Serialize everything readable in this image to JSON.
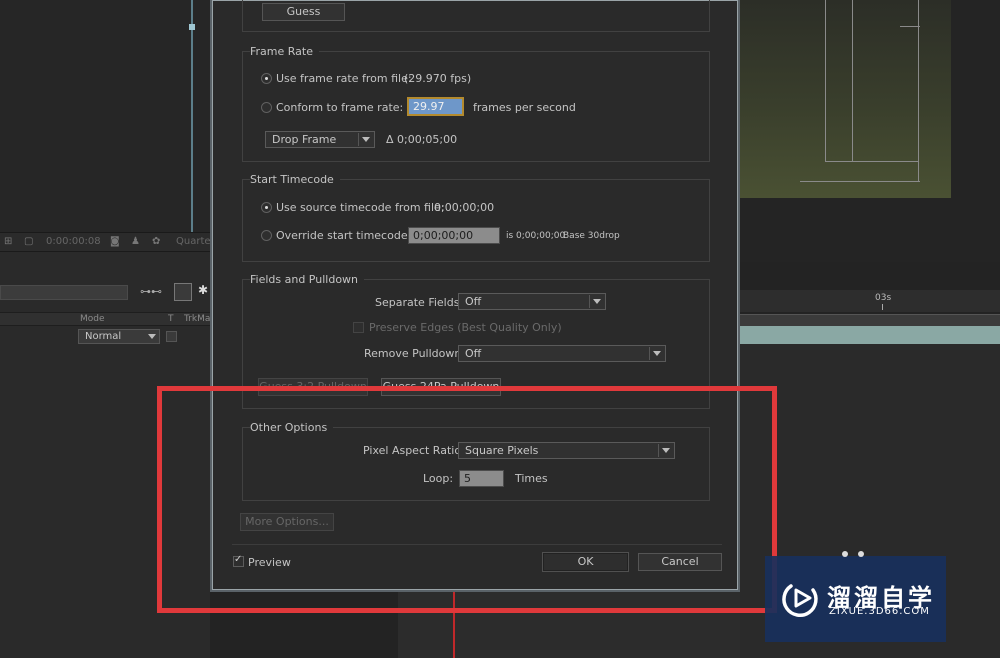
{
  "background": {
    "timecode": "0:00:00:08",
    "quarter_label": "Quarte",
    "col_mode": "Mode",
    "col_t": "T",
    "col_trkmat": "TrkMa",
    "mode_value": "Normal",
    "ruler_label": "03s"
  },
  "dialog": {
    "guess_button": "Guess",
    "frame_rate": {
      "title": "Frame Rate",
      "use_from_file_label": "Use frame rate from file:",
      "file_fps": "(29.970 fps)",
      "conform_label": "Conform to frame rate:",
      "conform_value": "29.97",
      "fps_unit": "frames per second",
      "drop_frame_value": "Drop Frame",
      "delta_text": "Δ 0;00;05;00"
    },
    "start_timecode": {
      "title": "Start Timecode",
      "use_source_label": "Use source timecode from file:",
      "source_value": "0;00;00;00",
      "override_label": "Override start timecode:",
      "override_value": "0;00;00;00",
      "is_text": "is 0;00;00;00",
      "base_text": "Base 30drop"
    },
    "fields_pulldown": {
      "title": "Fields and Pulldown",
      "separate_fields_label": "Separate Fields:",
      "separate_fields_value": "Off",
      "preserve_edges_label": "Preserve Edges (Best Quality Only)",
      "remove_pulldown_label": "Remove Pulldown:",
      "remove_pulldown_value": "Off",
      "guess_32_label": "Guess 3:2 Pulldown",
      "guess_24p_label": "Guess 24Pa Pulldown"
    },
    "other_options": {
      "title": "Other Options",
      "par_label": "Pixel Aspect Ratio:",
      "par_value": "Square Pixels",
      "loop_label": "Loop:",
      "loop_value": "5",
      "loop_unit": "Times"
    },
    "more_options_label": "More Options...",
    "preview_label": "Preview",
    "ok_label": "OK",
    "cancel_label": "Cancel"
  },
  "watermark": {
    "brand_cn": "溜溜自学",
    "brand_url": "ZIXUE.3D66.COM"
  },
  "colors": {
    "highlight_red": "#e0393b",
    "selected_field": "#6e97c9",
    "logo_bg": "#18305c"
  }
}
